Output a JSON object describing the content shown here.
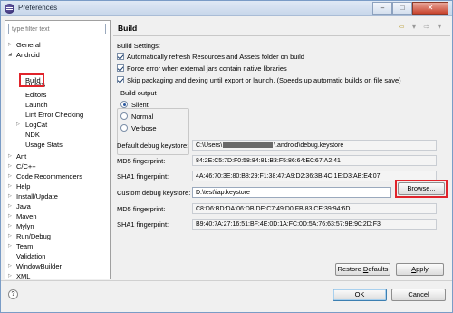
{
  "window": {
    "title": "Preferences",
    "minimize": "–",
    "maximize": "□",
    "close": "✕"
  },
  "filter": {
    "placeholder": "type filter text"
  },
  "tree": {
    "general": "General",
    "android": "Android",
    "build": "Build",
    "ddms": "DDMS",
    "editors": "Editors",
    "launch": "Launch",
    "lint": "Lint Error Checking",
    "logcat": "LogCat",
    "ndk": "NDK",
    "usage": "Usage Stats",
    "ant": "Ant",
    "cpp": "C/C++",
    "code_rec": "Code Recommenders",
    "help": "Help",
    "install": "Install/Update",
    "java": "Java",
    "maven": "Maven",
    "mylyn": "Mylyn",
    "rundebug": "Run/Debug",
    "team": "Team",
    "validation": "Validation",
    "windowbuilder": "WindowBuilder",
    "xml": "XML"
  },
  "page": {
    "title": "Build",
    "nav": {
      "back": "⇦",
      "dropdown": "▾",
      "forward": "⇨",
      "menu": "▾"
    },
    "settings_label": "Build Settings:",
    "checks": [
      "Automatically refresh Resources and Assets folder on build",
      "Force error when external jars contain native libraries",
      "Skip packaging and dexing until export or launch. (Speeds up automatic builds on file save)"
    ],
    "output_group": "Build output",
    "output_options": [
      "Silent",
      "Normal",
      "Verbose"
    ],
    "default_keystore_label": "Default debug keystore:",
    "default_keystore_prefix": "C:\\Users\\",
    "default_keystore_suffix": "\\.android\\debug.keystore",
    "md5_label": "MD5 fingerprint:",
    "md5_value": "84:2E:C5:7D:F0:58:84:81:B3:F5:86:64:E0:67:A2:41",
    "sha1_label": "SHA1 fingerprint:",
    "sha1_value": "4A:46:70:3E:80:B8:29:F1:38:47:A9:D2:36:3B:4C:1E:D3:AB:E4:07",
    "custom_keystore_label": "Custom debug keystore:",
    "custom_keystore_value": "D:\\test\\iap.keystore",
    "browse": "Browse...",
    "md5_label_2": "MD5 fingerprint:",
    "md5_value_2": "C8:D6:BD:DA:06:DB:DE:C7:49:D0:FB:83:CE:39:94:6D",
    "sha1_label_2": "SHA1 fingerprint:",
    "sha1_value_2": "B9:40:7A:27:16:51:BF:4E:0D:1A:FC:0D:5A:76:63:57:9B:90:2D:F3"
  },
  "buttons": {
    "restore_pre": "Restore ",
    "restore_u": "D",
    "restore_post": "efaults",
    "apply_u": "A",
    "apply_post": "pply",
    "ok": "OK",
    "cancel": "Cancel"
  },
  "help": "?"
}
